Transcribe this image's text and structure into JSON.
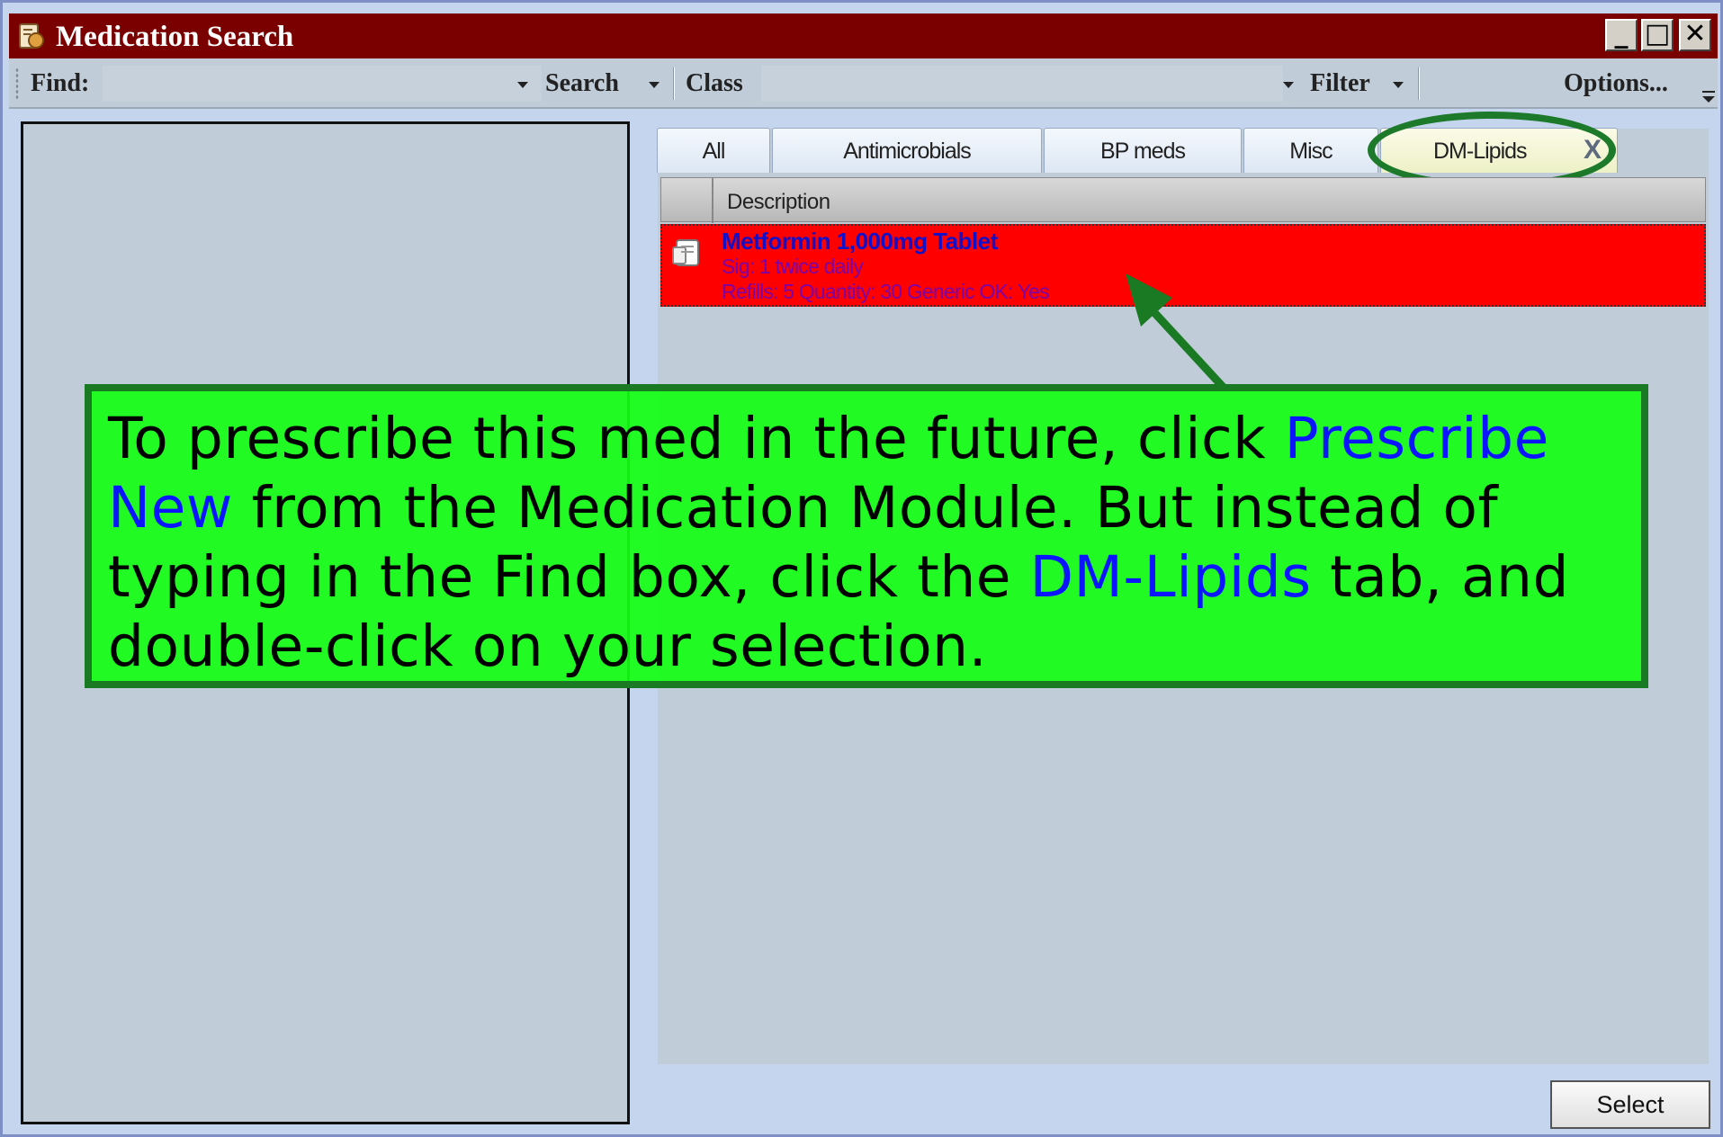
{
  "window": {
    "title": "Medication Search",
    "title_icon": "medication-app-icon",
    "controls": {
      "minimize": "_",
      "maximize": "□",
      "close": "✕"
    }
  },
  "toolbar": {
    "find_label": "Find:",
    "find_value": "",
    "search_label": "Search",
    "class_label": "Class",
    "class_value": "",
    "filter_label": "Filter",
    "options_label": "Options..."
  },
  "tabs": [
    {
      "label": "All"
    },
    {
      "label": "Antimicrobials"
    },
    {
      "label": "BP meds"
    },
    {
      "label": "Misc"
    },
    {
      "label": "DM-Lipids",
      "active": true,
      "close": "X"
    }
  ],
  "grid": {
    "column_header": "Description",
    "rows": [
      {
        "name": "Metformin 1,000mg Tablet",
        "sig": "Sig: 1 twice daily",
        "refills": "Refills: 5 Quantity: 30 Generic OK: Yes"
      }
    ]
  },
  "footer": {
    "select_label": "Select"
  },
  "callout": {
    "part1": "To prescribe this med in the future, click ",
    "keyword1": "Prescribe New",
    "part2": " from the Medication Module.  But instead of typing in the Find box, click the ",
    "keyword2": "DM-Lipids",
    "part3": " tab, and double-click on your selection."
  },
  "colors": {
    "titlebar": "#7a0000",
    "window_bg": "#c5d5ee",
    "selected_row": "#ff0000",
    "callout_bg": "#14ff14",
    "callout_border": "#1a7a24",
    "callout_keyword": "#0b16ff",
    "highlight_ring": "#1d7a2a"
  }
}
